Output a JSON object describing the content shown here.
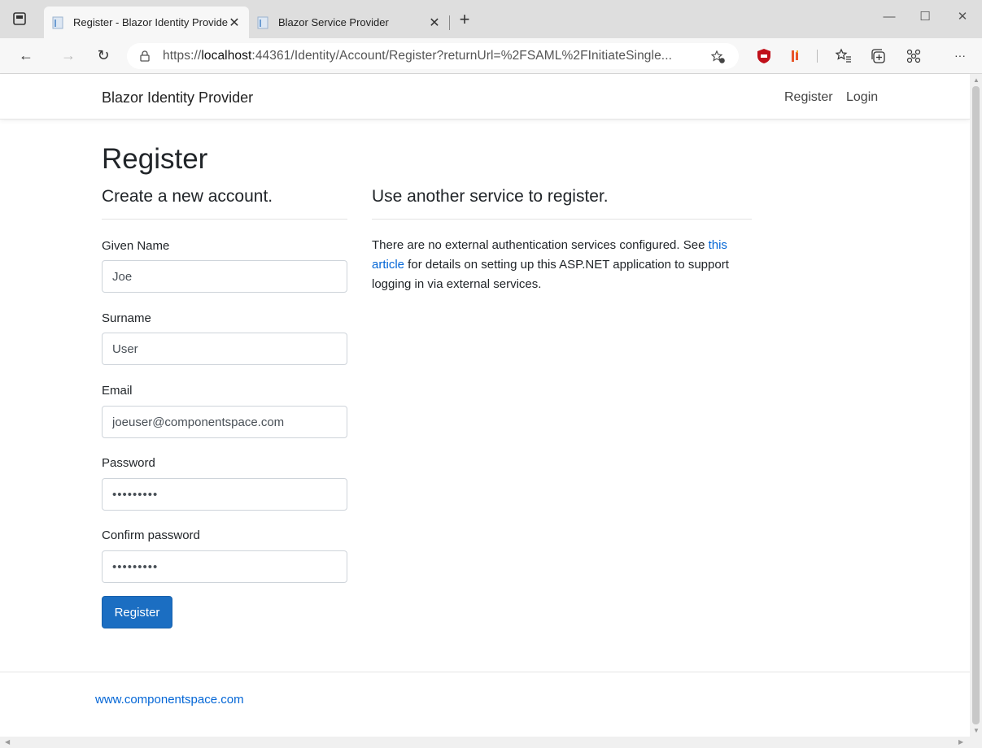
{
  "browser": {
    "tabs": [
      {
        "title": "Register - Blazor Identity Provide",
        "active": true
      },
      {
        "title": "Blazor Service Provider",
        "active": false
      }
    ],
    "close_glyph": "✕",
    "new_tab_glyph": "+",
    "window_controls": {
      "minimize": "—",
      "maximize": "☐",
      "close": "✕"
    },
    "nav": {
      "back": "←",
      "forward": "→",
      "refresh": "↻",
      "more": "···"
    },
    "url_prefix": "https://",
    "url_host": "localhost",
    "url_rest": ":44361/Identity/Account/Register?returnUrl=%2FSAML%2FInitiateSingle...",
    "extensions": [
      "favorites-add-icon",
      "ublock-icon",
      "bitwarden-icon",
      "favorites-icon",
      "collections-icon",
      "extensions-icon"
    ]
  },
  "site": {
    "brand": "Blazor Identity Provider",
    "nav": {
      "register": "Register",
      "login": "Login"
    }
  },
  "page": {
    "title": "Register",
    "form_heading": "Create a new account.",
    "external_heading": "Use another service to register.",
    "fields": {
      "given_name": {
        "label": "Given Name",
        "value": "Joe"
      },
      "surname": {
        "label": "Surname",
        "value": "User"
      },
      "email": {
        "label": "Email",
        "value": "joeuser@componentspace.com"
      },
      "password": {
        "label": "Password",
        "value": "•••••••••"
      },
      "confirm_password": {
        "label": "Confirm password",
        "value": "•••••••••"
      }
    },
    "submit_label": "Register",
    "external_text_1": "There are no external authentication services configured. See ",
    "external_link": "this article",
    "external_text_2": " for details on setting up this ASP.NET application to support logging in via external services."
  },
  "footer": {
    "link": "www.componentspace.com"
  },
  "colors": {
    "primary": "#1b6ec2",
    "link": "#0366d6"
  }
}
